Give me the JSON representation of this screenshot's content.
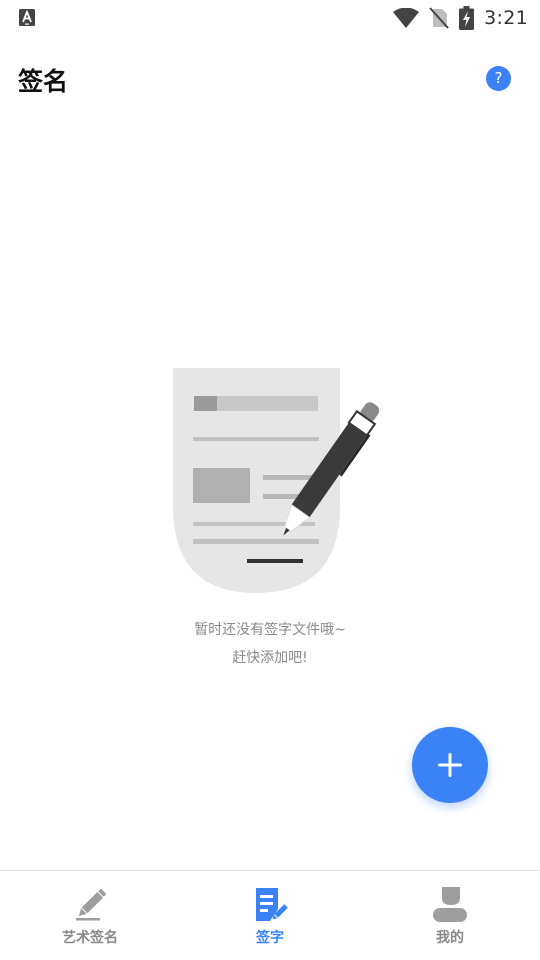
{
  "status_bar": {
    "time": "3:21",
    "app_icon": "text-a-icon",
    "icons": [
      "wifi-icon",
      "no-sim-icon",
      "battery-charging-icon"
    ]
  },
  "header": {
    "title": "签名",
    "help_icon": "help-icon"
  },
  "empty_state": {
    "illustration": "document-signing-pen-illustration",
    "line1": "暂时还没有签字文件哦~",
    "line2": "赶快添加吧!"
  },
  "fab": {
    "icon": "plus-icon"
  },
  "bottom_nav": {
    "items": [
      {
        "label": "艺术签名",
        "icon": "pen-icon",
        "active": false
      },
      {
        "label": "签字",
        "icon": "sign-document-icon",
        "active": true
      },
      {
        "label": "我的",
        "icon": "profile-icon",
        "active": false
      }
    ]
  },
  "colors": {
    "accent": "#3b82f6",
    "inactive": "#888888",
    "illustration_gray": "#e6e6e6"
  }
}
